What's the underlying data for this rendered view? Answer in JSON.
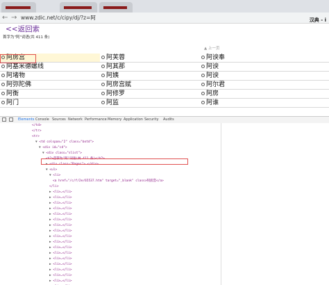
{
  "browser": {
    "url": "www.zdic.net/c/cipy/dj/?z=阿"
  },
  "page": {
    "header_right": "汉典 - i",
    "back_link": "<<返回索",
    "subtitle": "首字为\"阿\"词语(共 411 条)",
    "prev_page": "▲ 上一页"
  },
  "words": [
    [
      "阿房宫",
      "阿芙蓉",
      "阿谀奉"
    ],
    [
      "阿基米德螺线",
      "阿其那",
      "阿谀"
    ],
    [
      "阿堵物",
      "阿姨",
      "阿谀"
    ],
    [
      "阿弥陀佛",
      "阿房宫赋",
      "阿尔君"
    ],
    [
      "阿衡",
      "阿修罗",
      "阿房"
    ],
    [
      "阿门",
      "阿监",
      "阿谁"
    ]
  ],
  "devtools": {
    "tabs": [
      "Elements",
      "Console",
      "Sources",
      "Network",
      "Performance",
      "Memory",
      "Application",
      "Security",
      "Audits"
    ],
    "active_tab": "Elements"
  },
  "code_lines": [
    {
      "indent": 0,
      "html": "</td>"
    },
    {
      "indent": 0,
      "html": "</tr>"
    },
    {
      "indent": 0,
      "html": "<tr>"
    },
    {
      "indent": 1,
      "tri": "▼",
      "html": "<td colspan=\"2\" class=\"botd\">"
    },
    {
      "indent": 2,
      "tri": "▼",
      "html": "<div id=\"cd\">"
    },
    {
      "indent": 3,
      "tri": "▼",
      "html": "<div class=\"slist\">"
    },
    {
      "indent": 4,
      "html": "<h2>首字为\"阿\"词语(共 411 条)</h2>"
    },
    {
      "indent": 4,
      "tri": "▶",
      "html": "<div class=\"Pages\">…</div>"
    },
    {
      "indent": 4,
      "tri": "▼",
      "html": "<ul>"
    },
    {
      "indent": 5,
      "tri": "▼",
      "html": "<li>"
    },
    {
      "indent": 6,
      "html": "<a href=\"/c/f/2e/65537.htm\" target=\"_blank\" class>阿房宫</a>"
    },
    {
      "indent": 5,
      "html": "</li>"
    },
    {
      "indent": 5,
      "tri": "▶",
      "html": "<li>…</li>"
    },
    {
      "indent": 5,
      "tri": "▶",
      "html": "<li>…</li>"
    },
    {
      "indent": 5,
      "tri": "▶",
      "html": "<li>…</li>"
    },
    {
      "indent": 5,
      "tri": "▶",
      "html": "<li>…</li>"
    },
    {
      "indent": 5,
      "tri": "▶",
      "html": "<li>…</li>"
    },
    {
      "indent": 5,
      "tri": "▶",
      "html": "<li>…</li>"
    },
    {
      "indent": 5,
      "tri": "▶",
      "html": "<li>…</li>"
    },
    {
      "indent": 5,
      "tri": "▶",
      "html": "<li>…</li>"
    },
    {
      "indent": 5,
      "tri": "▶",
      "html": "<li>…</li>"
    },
    {
      "indent": 5,
      "tri": "▶",
      "html": "<li>…</li>"
    },
    {
      "indent": 5,
      "tri": "▶",
      "html": "<li>…</li>"
    },
    {
      "indent": 5,
      "tri": "▶",
      "html": "<li>…</li>"
    },
    {
      "indent": 5,
      "tri": "▶",
      "html": "<li>…</li>"
    },
    {
      "indent": 5,
      "tri": "▶",
      "html": "<li>…</li>"
    },
    {
      "indent": 5,
      "tri": "▶",
      "html": "<li>…</li>"
    },
    {
      "indent": 5,
      "tri": "▶",
      "html": "<li>…</li>"
    },
    {
      "indent": 5,
      "tri": "▶",
      "html": "<li>…</li>"
    },
    {
      "indent": 5,
      "tri": "▶",
      "html": "<li>…</li>"
    }
  ],
  "colors": {
    "link_purple": "#6a2e98",
    "highlight_red": "#e05050",
    "devtools_active": "#1a73e8"
  }
}
